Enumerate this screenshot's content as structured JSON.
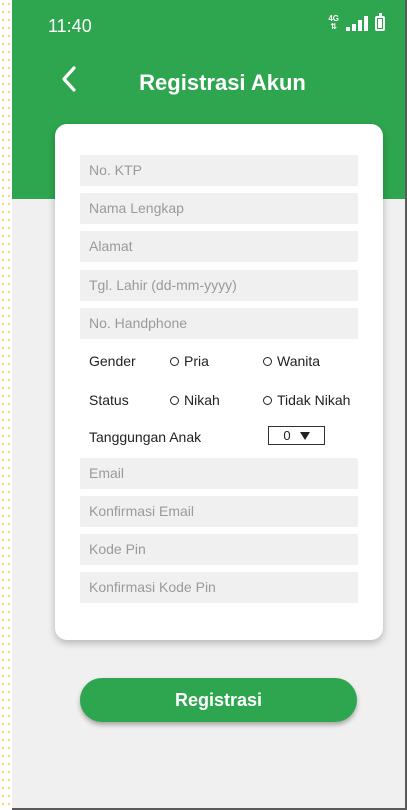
{
  "status_bar": {
    "time": "11:40",
    "network": "4G"
  },
  "header": {
    "title": "Registrasi Akun"
  },
  "form": {
    "ktp_placeholder": "No. KTP",
    "name_placeholder": "Nama Lengkap",
    "address_placeholder": "Alamat",
    "birth_placeholder": "Tgl. Lahir (dd-mm-yyyy)",
    "phone_placeholder": "No. Handphone",
    "gender_label": "Gender",
    "gender_options": [
      "Pria",
      "Wanita"
    ],
    "status_label": "Status",
    "status_options": [
      "Nikah",
      "Tidak Nikah"
    ],
    "dependents_label": "Tanggungan Anak",
    "dependents_value": "0",
    "email_placeholder": "Email",
    "email_confirm_placeholder": "Konfirmasi Email",
    "pin_placeholder": "Kode Pin",
    "pin_confirm_placeholder": "Konfirmasi Kode Pin"
  },
  "register_button": "Registrasi",
  "colors": {
    "primary": "#2ea64f",
    "field_bg": "#f0f0f0",
    "screen_bg": "#f0f0f0"
  }
}
